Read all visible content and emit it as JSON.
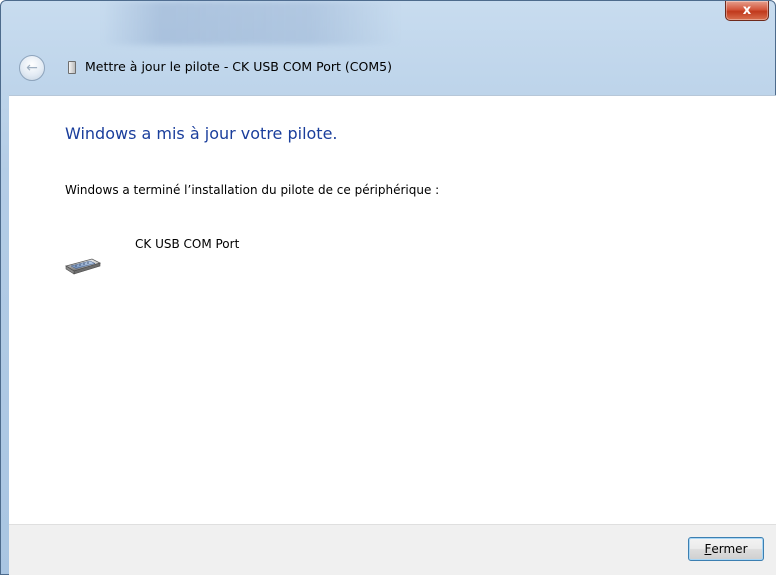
{
  "window": {
    "title": "Mettre à jour le pilote - CK USB COM Port (COM5)",
    "close_glyph": "x"
  },
  "content": {
    "heading": "Windows a mis à jour votre pilote.",
    "description": "Windows a terminé l’installation du pilote de ce périphérique :",
    "device_name": "CK USB COM Port",
    "device_icon": "serial-port-icon"
  },
  "footer": {
    "close_accel": "F",
    "close_rest": "ermer"
  },
  "colors": {
    "heading": "#1a3e9c",
    "footer_bg": "#f0f0f0",
    "close_button": "#c0391c"
  }
}
